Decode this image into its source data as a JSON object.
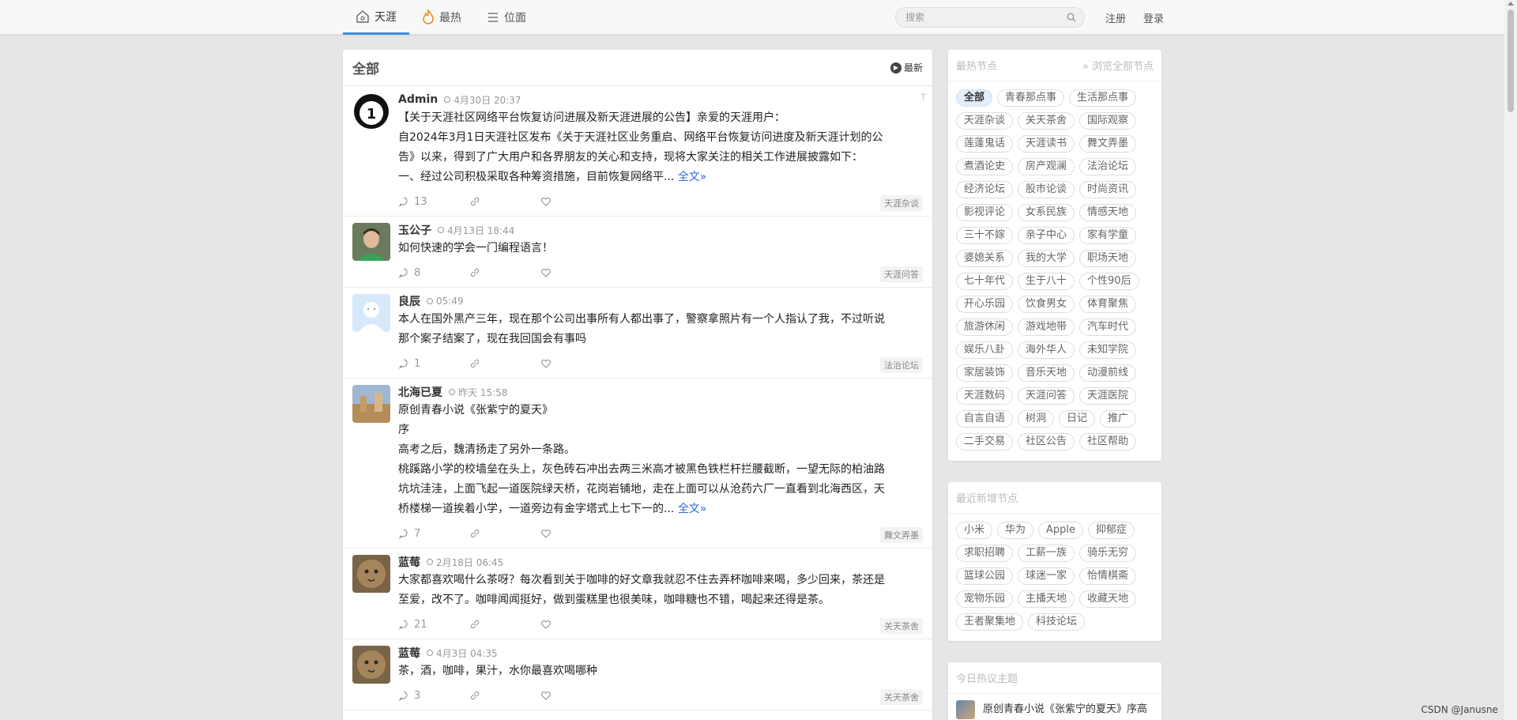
{
  "nav": {
    "items": [
      {
        "label": "天涯",
        "icon": "home-icon",
        "active": true
      },
      {
        "label": "最热",
        "icon": "flame-icon",
        "active": false
      },
      {
        "label": "位面",
        "icon": "list-icon",
        "active": false
      }
    ],
    "search_placeholder": "搜索",
    "register": "注册",
    "login": "登录"
  },
  "main": {
    "title": "全部",
    "sort_label": "最新",
    "posts": [
      {
        "author": "Admin",
        "time": "4月30日 20:37",
        "pinned": true,
        "lines": [
          "【关于天涯社区网络平台恢复访问进展及新天涯进展的公告】亲爱的天涯用户：",
          "自2024年3月1日天涯社区发布《关于天涯社区业务重启、网络平台恢复访问进度及新天涯计划的公",
          "告》以来，得到了广大用户和各界朋友的关心和支持，现将大家关注的相关工作进展披露如下：",
          "一、经过公司积极采取各种筹资措施，目前恢复网络平..."
        ],
        "more": "全文»",
        "comments": "13",
        "tag": "天涯杂谈"
      },
      {
        "author": "玉公子",
        "time": "4月13日 18:44",
        "lines": [
          "如何快速的学会一门编程语言！"
        ],
        "comments": "8",
        "tag": "天涯问答"
      },
      {
        "author": "良辰",
        "time": "05:49",
        "lines": [
          "本人在国外黑产三年，现在那个公司出事所有人都出事了，警察拿照片有一个人指认了我，不过听说",
          "那个案子结案了，现在我回国会有事吗"
        ],
        "comments": "1",
        "tag": "法治论坛"
      },
      {
        "author": "北海已夏",
        "time": "昨天 15:58",
        "lines": [
          "原创青春小说《张紫宁的夏天》",
          "序",
          "高考之后，魏清扬走了另外一条路。",
          "桃蹊路小学的校墙垒在头上，灰色砖石冲出去两三米高才被黑色铁栏杆拦腰截断，一望无际的柏油路",
          "坑坑洼洼，上面飞起一道医院绿天桥，花岗岩铺地，走在上面可以从沧药六厂一直看到北海西区，天",
          "桥楼梯一道挨着小学，一道旁边有金字塔式上七下一的..."
        ],
        "more": "全文»",
        "comments": "7",
        "tag": "舞文弄墨"
      },
      {
        "author": "蓝莓",
        "time": "2月18日 06:45",
        "lines": [
          "大家都喜欢喝什么茶呀？每次看到关于咖啡的好文章我就忍不住去弄杯咖啡来喝，多少回来，茶还是",
          "至爱，改不了。咖啡闻闻挺好，做到蛋糕里也很美味，咖啡糖也不错，喝起来还得是茶。"
        ],
        "comments": "21",
        "tag": "关天茶舍"
      },
      {
        "author": "蓝莓",
        "time": "4月3日 04:35",
        "lines": [
          "茶，酒，咖啡，果汁，水你最喜欢喝哪种"
        ],
        "comments": "3",
        "tag": "关天茶舍"
      }
    ]
  },
  "sidebar": {
    "hot_nodes": {
      "title": "最热节点",
      "browse_all": "» 浏览全部节点",
      "tags": [
        "全部",
        "青春那点事",
        "生活那点事",
        "天涯杂谈",
        "关天茶舍",
        "国际观察",
        "莲蓬鬼话",
        "天涯读书",
        "舞文弄墨",
        "煮酒论史",
        "房产观澜",
        "法治论坛",
        "经济论坛",
        "股市论谈",
        "时尚资讯",
        "影视评论",
        "女系民族",
        "情感天地",
        "三十不嫁",
        "亲子中心",
        "家有学童",
        "婆媳关系",
        "我的大学",
        "职场天地",
        "七十年代",
        "生于八十",
        "个性90后",
        "开心乐园",
        "饮食男女",
        "体育聚焦",
        "旅游休闲",
        "游戏地带",
        "汽车时代",
        "娱乐八卦",
        "海外华人",
        "未知学院",
        "家居装饰",
        "音乐天地",
        "动漫前线",
        "天涯数码",
        "天涯问答",
        "天涯医院",
        "自言自语",
        "树洞",
        "日记",
        "推广",
        "二手交易",
        "社区公告",
        "社区帮助"
      ]
    },
    "new_nodes": {
      "title": "最近新增节点",
      "tags": [
        "小米",
        "华为",
        "Apple",
        "抑郁症",
        "求职招聘",
        "工薪一族",
        "骑乐无穷",
        "篮球公园",
        "球迷一家",
        "怡情棋斋",
        "宠物乐园",
        "主播天地",
        "收藏天地",
        "王者聚集地",
        "科技论坛"
      ]
    },
    "today_hot": {
      "title": "今日热议主题",
      "items": [
        "原创青春小说《张紫宁的夏天》序高"
      ]
    }
  },
  "watermark": "CSDN @Janusne"
}
